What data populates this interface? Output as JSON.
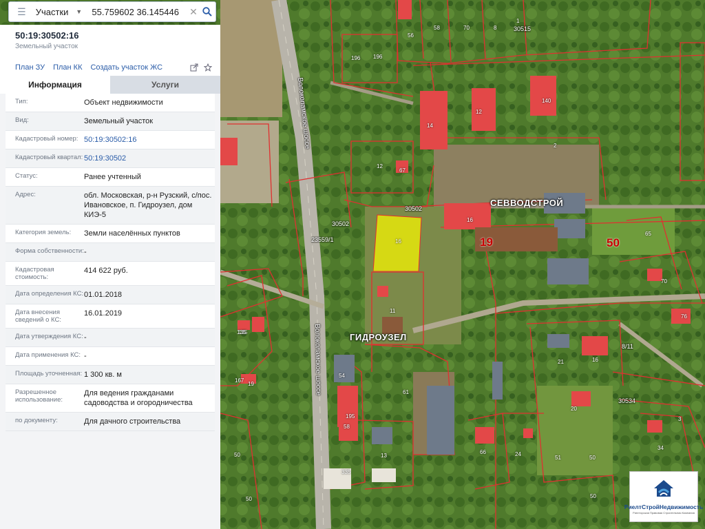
{
  "search": {
    "layer": "Участки",
    "query": "55.759602 36.145446"
  },
  "panel": {
    "cadastral_number": "50:19:30502:16",
    "object_type": "Земельный участок",
    "links": [
      "План ЗУ",
      "План КК",
      "Создать участок ЖС"
    ],
    "tabs": {
      "info": "Информация",
      "services": "Услуги"
    },
    "rows": [
      {
        "k": "Тип:",
        "v": "Объект недвижимости"
      },
      {
        "k": "Вид:",
        "v": "Земельный участок"
      },
      {
        "k": "Кадастровый номер:",
        "v": "50:19:30502:16"
      },
      {
        "k": "Кадастровый квартал:",
        "v": "50:19:30502"
      },
      {
        "k": "Статус:",
        "v": "Ранее учтенный"
      },
      {
        "k": "Адрес:",
        "v": "обл. Московская, р-н Рузский, с/пос. Ивановское, п. Гидроузел, дом КИЭ-5"
      },
      {
        "k": "Категория земель:",
        "v": "Земли населённых пунктов"
      },
      {
        "k": "Форма собственности:",
        "v": "-"
      },
      {
        "k": "Кадастровая стоимость:",
        "v": "414 622 руб."
      },
      {
        "k": "Дата определения КС:",
        "v": "01.01.2018"
      },
      {
        "k": "Дата внесения сведений о КС:",
        "v": "16.01.2019"
      },
      {
        "k": "Дата утверждения КС:",
        "v": "-"
      },
      {
        "k": "Дата применения КС:",
        "v": "-"
      },
      {
        "k": "Площадь уточненная:",
        "v": "1 300 кв. м"
      },
      {
        "k": "Разрешенное использование:",
        "v": "Для ведения гражданами садоводства и огородничества"
      },
      {
        "k": "по документу:",
        "v": "Для дачного строительства"
      }
    ]
  },
  "map": {
    "labels": {
      "sevvodstroy": "СЕВВОДСТРОЙ",
      "gidrouzel": "ГИДРОУЗЕЛ",
      "highway": "Волоколамское шоссе",
      "num_19": "19",
      "num_50": "50"
    },
    "quarter_codes": [
      "30515",
      "30502",
      "30502",
      "23559/1",
      "30534",
      "8/11"
    ],
    "parcel_numbers": [
      "196",
      "196",
      "56",
      "58",
      "70",
      "8",
      "1",
      "140",
      "12",
      "14",
      "12",
      "2",
      "67",
      "16",
      "135",
      "19",
      "65",
      "70",
      "11",
      "135",
      "76",
      "167",
      "21",
      "16",
      "54",
      "61",
      "20",
      "30534",
      "58",
      "195",
      "13",
      "66",
      "24",
      "51",
      "50",
      "34",
      "3",
      "335",
      "50",
      "50",
      "50"
    ],
    "selected_parcel_number": "16"
  },
  "logo": {
    "brand": "РиелтСтройНедвижимость",
    "tagline": "Риелторская Правовая Строительная Компания"
  },
  "colors": {
    "selected_parcel": "#e6e60a",
    "parcel_border": "#e03030",
    "roof": "#e34848",
    "link": "#2a5ca8"
  }
}
